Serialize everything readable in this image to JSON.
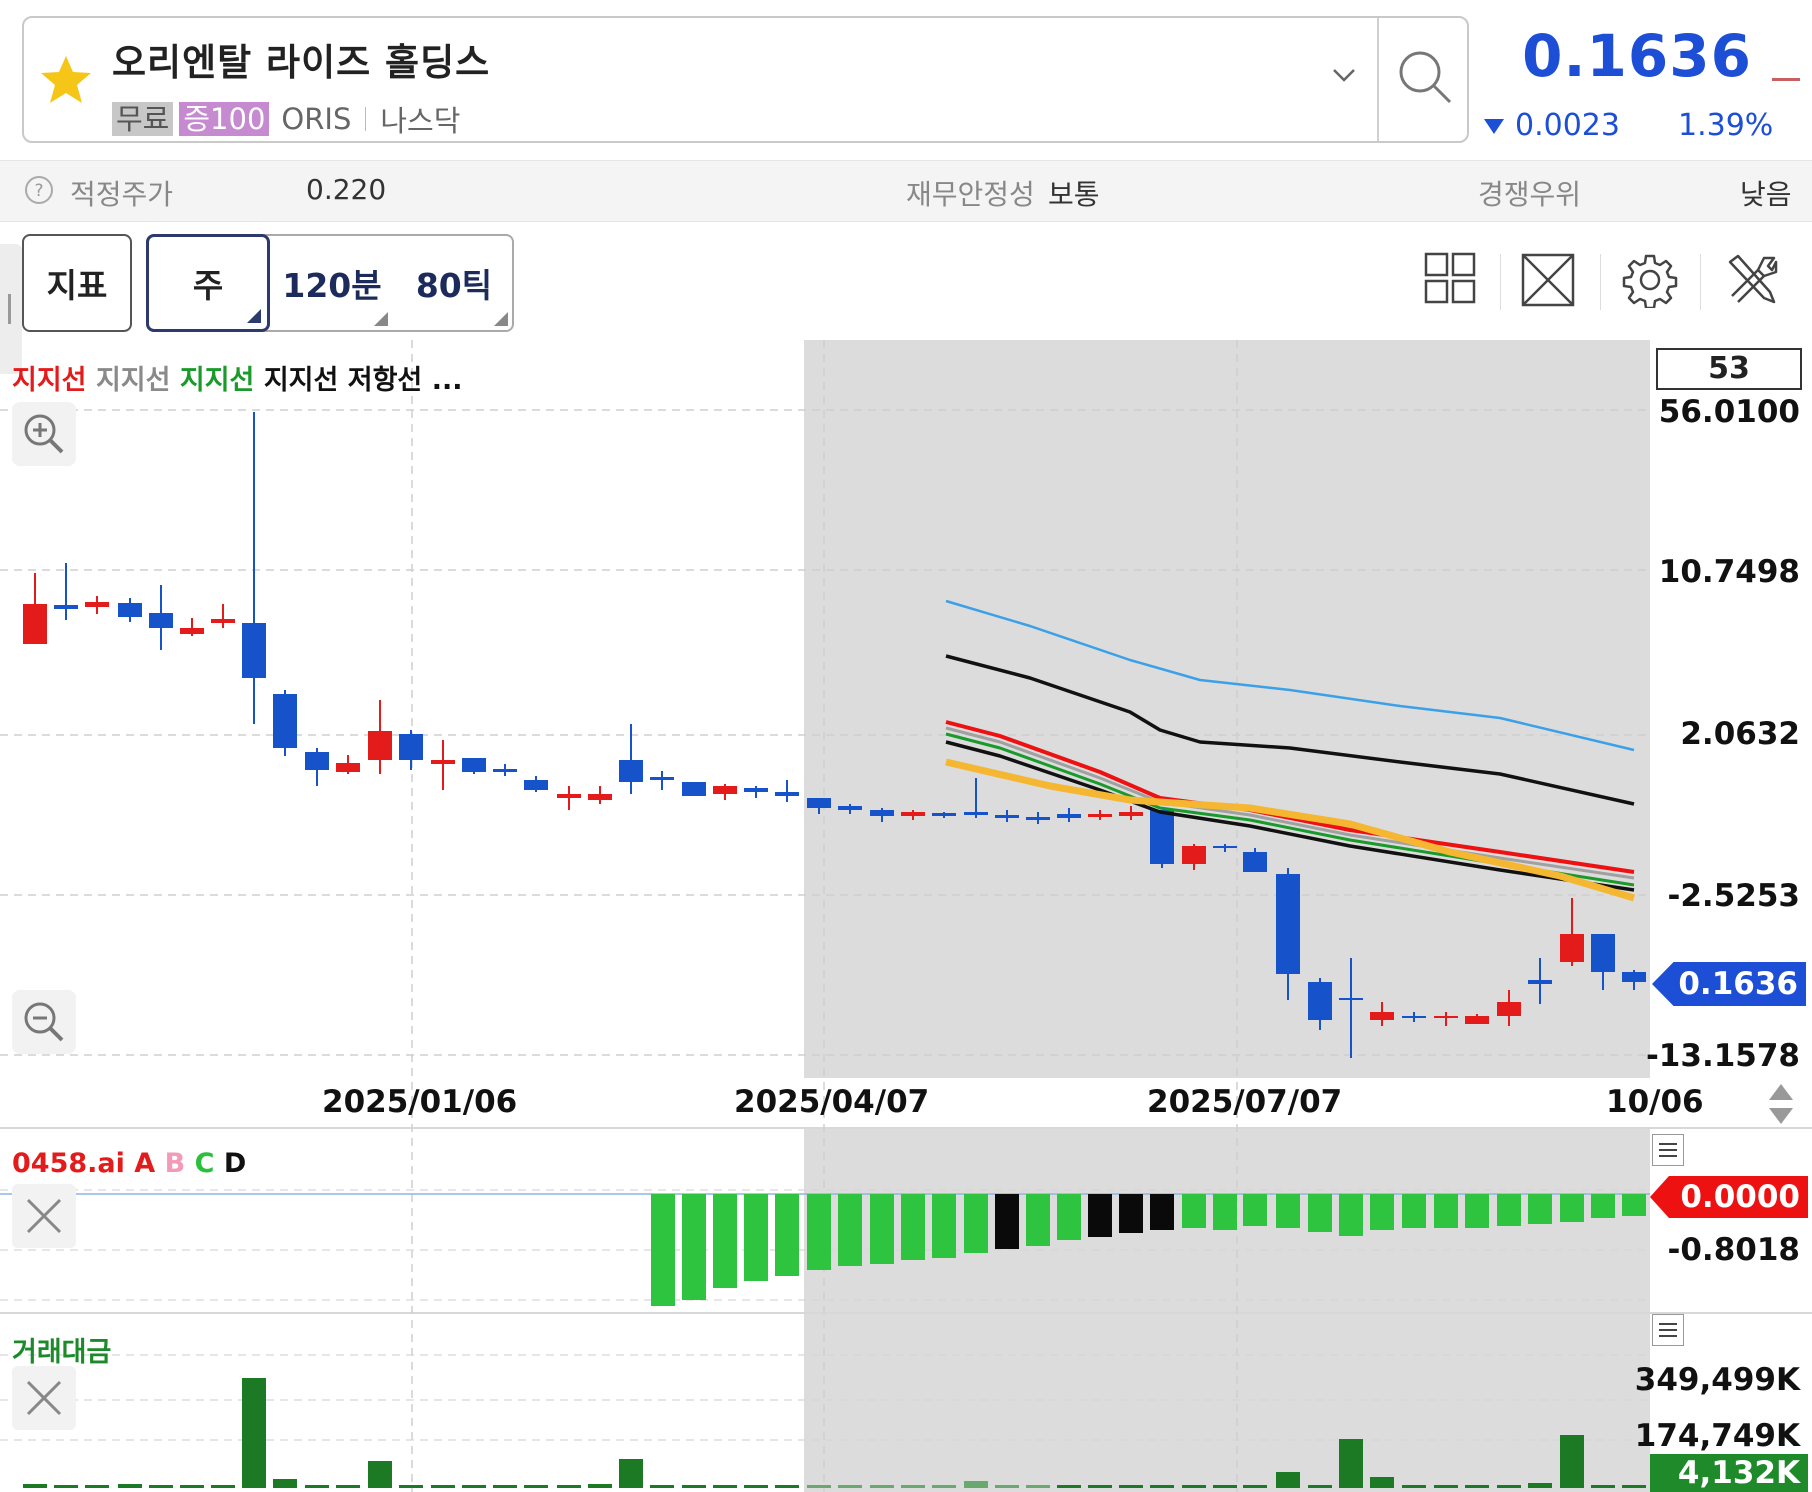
{
  "header": {
    "stock_name": "오리엔탈 라이즈 홀딩스",
    "tags": {
      "free": "무료",
      "margin": "증100",
      "ticker": "ORIS",
      "exchange": "나스닥"
    },
    "price": "0.1636",
    "change": "0.0023",
    "change_pct": "1.39%",
    "change_direction": "down",
    "price_color": "#1d4fd6"
  },
  "info_bar": {
    "fair_price_label": "적정주가",
    "fair_price_value": "0.220",
    "stability_label": "재무안정성",
    "stability_value": "보통",
    "competitive_label": "경쟁우위",
    "competitive_value": "낮음"
  },
  "toolbar": {
    "indicator_label": "지표",
    "periods": [
      "주",
      "120분",
      "80틱"
    ],
    "selected_period": "주",
    "icons": [
      "grid-layout-icon",
      "expand-icon",
      "settings-gear-icon",
      "tools-icon"
    ]
  },
  "main_chart": {
    "legend": [
      {
        "text": "지지선",
        "color": "#e31b1b"
      },
      {
        "text": "지지선",
        "color": "#8a8a8a"
      },
      {
        "text": "지지선",
        "color": "#1a9a2a"
      },
      {
        "text": "지지선",
        "color": "#111111"
      },
      {
        "text": "저항선",
        "color": "#111111"
      },
      {
        "text": "...",
        "color": "#111111"
      }
    ],
    "box_value": "53",
    "y_labels": [
      "56.0100",
      "10.7498",
      "2.0632",
      "-2.5253",
      "-13.1578"
    ],
    "current_price_label": "0.1636",
    "x_labels": [
      "2025/01/06",
      "2025/04/07",
      "2025/07/07",
      "10/06"
    ]
  },
  "indicator_panel": {
    "legend_name": "0458.ai",
    "legend_series": [
      {
        "text": "A",
        "color": "#e31b1b"
      },
      {
        "text": "B",
        "color": "#f29ab8"
      },
      {
        "text": "C",
        "color": "#2bbf3c"
      },
      {
        "text": "D",
        "color": "#111111"
      }
    ],
    "value_label": "0.0000",
    "axis_label": "-0.8018"
  },
  "volume_panel": {
    "legend": "거래대금",
    "axis_labels": [
      "349,499K",
      "174,749K"
    ],
    "current_label": "4,132K"
  },
  "chart_data": {
    "type": "candlestick",
    "period": "weekly",
    "y_axis_labels": [
      56.01,
      10.7498,
      2.0632,
      -2.5253,
      -13.1578
    ],
    "current_value": 0.1636,
    "note_colors": {
      "up": "#e31b1b",
      "down": "#1652c9"
    }
  }
}
